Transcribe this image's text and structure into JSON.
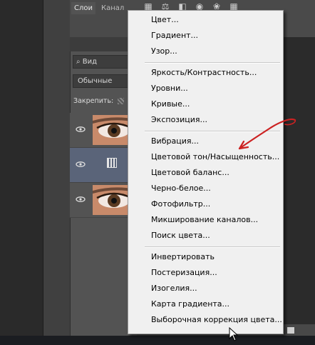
{
  "layers_panel": {
    "tabs": [
      "Слои",
      "Канал"
    ],
    "filter_value": "Вид",
    "blend_mode": "Обычные",
    "lock_label": "Закрепить:"
  },
  "menu": {
    "groups": [
      [
        "Цвет...",
        "Градиент...",
        "Узор..."
      ],
      [
        "Яркость/Контрастность...",
        "Уровни...",
        "Кривые...",
        "Экспозиция..."
      ],
      [
        "Вибрация...",
        "Цветовой тон/Насыщенность...",
        "Цветовой баланс...",
        "Черно-белое...",
        "Фотофильтр...",
        "Микширование каналов...",
        "Поиск цвета..."
      ],
      [
        "Инвертировать",
        "Постеризация...",
        "Изогелия...",
        "Карта градиента...",
        "Выборочная коррекция цвета..."
      ]
    ]
  },
  "annotation_color": "#cc2222",
  "icons": {
    "eye": "eye-icon",
    "adjustment": "adjustment-layer-icon",
    "lock": "lock-transparency-icon",
    "cursor": "mouse-cursor-icon"
  }
}
